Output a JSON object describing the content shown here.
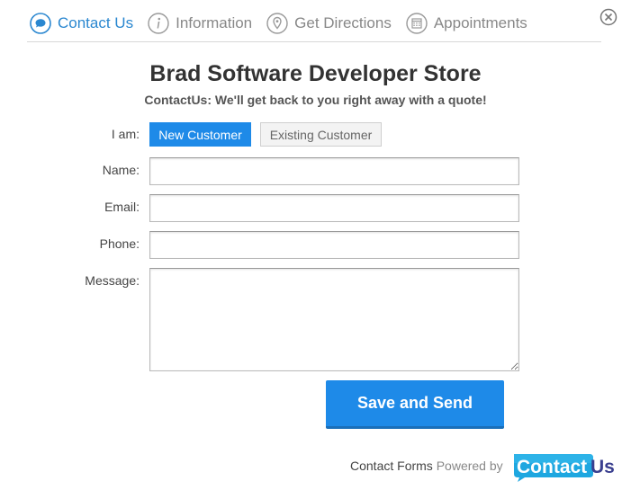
{
  "tabs": [
    {
      "label": "Contact Us",
      "icon": "chat-bubble-icon",
      "active": true
    },
    {
      "label": "Information",
      "icon": "info-icon"
    },
    {
      "label": "Get Directions",
      "icon": "map-pin-icon"
    },
    {
      "label": "Appointments",
      "icon": "calendar-icon"
    }
  ],
  "close_icon": "close-icon",
  "store": {
    "title": "Brad Software Developer Store",
    "subtitle": "ContactUs: We'll get back to you right away with a quote!"
  },
  "form": {
    "iam_label": "I am:",
    "new_customer_label": "New Customer",
    "existing_customer_label": "Existing Customer",
    "name_label": "Name:",
    "email_label": "Email:",
    "phone_label": "Phone:",
    "message_label": "Message:",
    "name_value": "",
    "email_value": "",
    "phone_value": "",
    "message_value": "",
    "submit_label": "Save and Send"
  },
  "footer": {
    "contact_forms": "Contact Forms",
    "powered_by": "Powered by",
    "logo_text_contact": "Contact",
    "logo_text_us": "Us"
  },
  "colors": {
    "accent": "#1e8ae8",
    "tab_active": "#2a87d0",
    "tab_inactive": "#888888",
    "logo_dark": "#3a3f8f"
  }
}
